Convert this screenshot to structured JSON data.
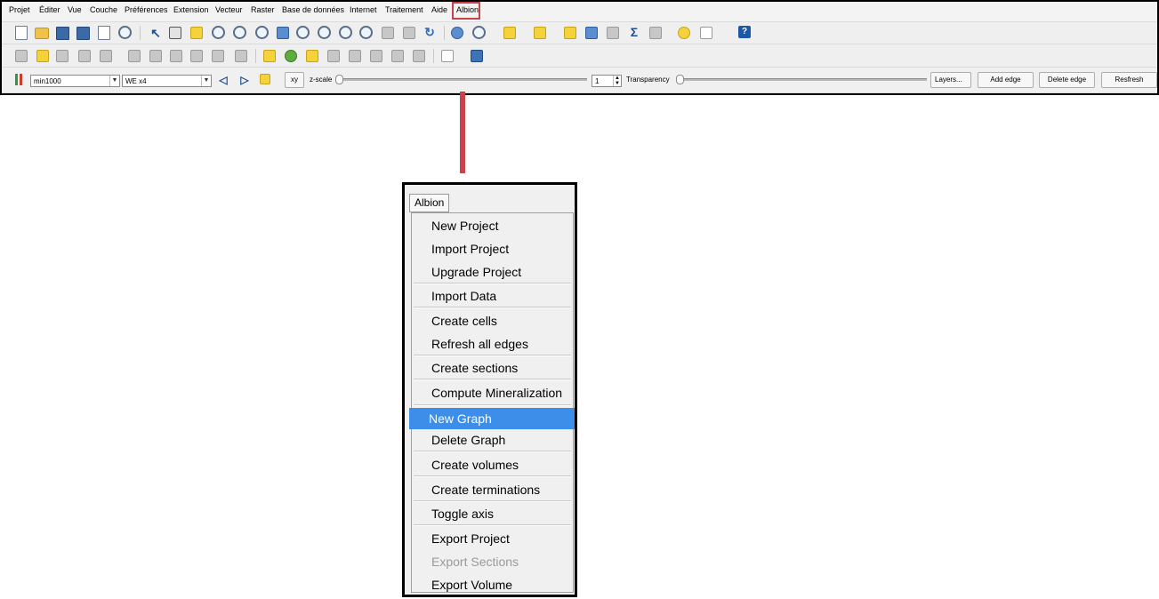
{
  "menubar": {
    "items": [
      "Projet",
      "Éditer",
      "Vue",
      "Couche",
      "Préférences",
      "Extension",
      "Vecteur",
      "Raster",
      "Base de données",
      "Internet",
      "Traitement",
      "Aide",
      "Albion"
    ]
  },
  "toolbar3": {
    "layer_combo": "min1000",
    "section_combo": "WE x4",
    "xy_button": "xy",
    "zscale_label": "z-scale",
    "zscale_value": "1",
    "transparency_label": "Transparency",
    "layers_button": "Layers...",
    "add_edge_button": "Add edge",
    "delete_edge_button": "Delete edge",
    "refresh_button": "Resfresh"
  },
  "toolbar1": {
    "icons": [
      "new-project-icon",
      "open-project-icon",
      "save-project-icon",
      "save-as-icon",
      "new-print-composer-icon",
      "composer-manager-icon",
      "touch-zoom-icon",
      "pan-icon",
      "pan-to-selection-icon",
      "zoom-in-icon",
      "zoom-out-icon",
      "zoom-native-icon",
      "zoom-full-icon",
      "zoom-to-selection-icon",
      "zoom-to-layer-icon",
      "zoom-last-icon",
      "zoom-next-icon",
      "new-bookmark-icon",
      "show-bookmarks-icon",
      "refresh-icon",
      "identify-icon",
      "select-features-icon",
      "select-by-expression-icon",
      "measure-icon",
      "statistics-icon",
      "attribute-table-icon",
      "field-calculator-icon",
      "sum-icon",
      "measure-line-icon",
      "map-tips-icon",
      "text-annotation-icon",
      "help-icon"
    ]
  },
  "toolbar2": {
    "icons": [
      "digitize-icon",
      "pencil-icon",
      "save-edits-icon",
      "add-feature-icon",
      "node-tool-icon",
      "delete-selected-icon",
      "cut-features-icon",
      "copy-features-icon",
      "paste-features-icon",
      "label-icon",
      "pin-labels-icon",
      "show-hide-labels-icon",
      "move-label-icon",
      "rotate-label-icon",
      "change-label-icon",
      "csw-icon",
      "python-icon"
    ]
  },
  "albion_menu": {
    "title": "Albion",
    "items": [
      {
        "label": "New Project",
        "state": "normal"
      },
      {
        "label": "Import Project",
        "state": "normal"
      },
      {
        "label": "Upgrade Project",
        "state": "normal"
      },
      {
        "label": "Import Data",
        "state": "normal"
      },
      {
        "label": "Create cells",
        "state": "normal"
      },
      {
        "label": "Refresh all edges",
        "state": "normal"
      },
      {
        "label": "Create sections",
        "state": "normal"
      },
      {
        "label": "Compute Mineralization",
        "state": "normal"
      },
      {
        "label": "New Graph",
        "state": "selected"
      },
      {
        "label": "Delete Graph",
        "state": "normal"
      },
      {
        "label": "Create volumes",
        "state": "normal"
      },
      {
        "label": "Create terminations",
        "state": "normal"
      },
      {
        "label": "Toggle axis",
        "state": "normal"
      },
      {
        "label": "Export Project",
        "state": "normal"
      },
      {
        "label": "Export Sections",
        "state": "disabled"
      },
      {
        "label": "Export Volume",
        "state": "normal"
      }
    ]
  },
  "colors": {
    "highlight": "#c9414a",
    "selection": "#3d8ee8"
  }
}
